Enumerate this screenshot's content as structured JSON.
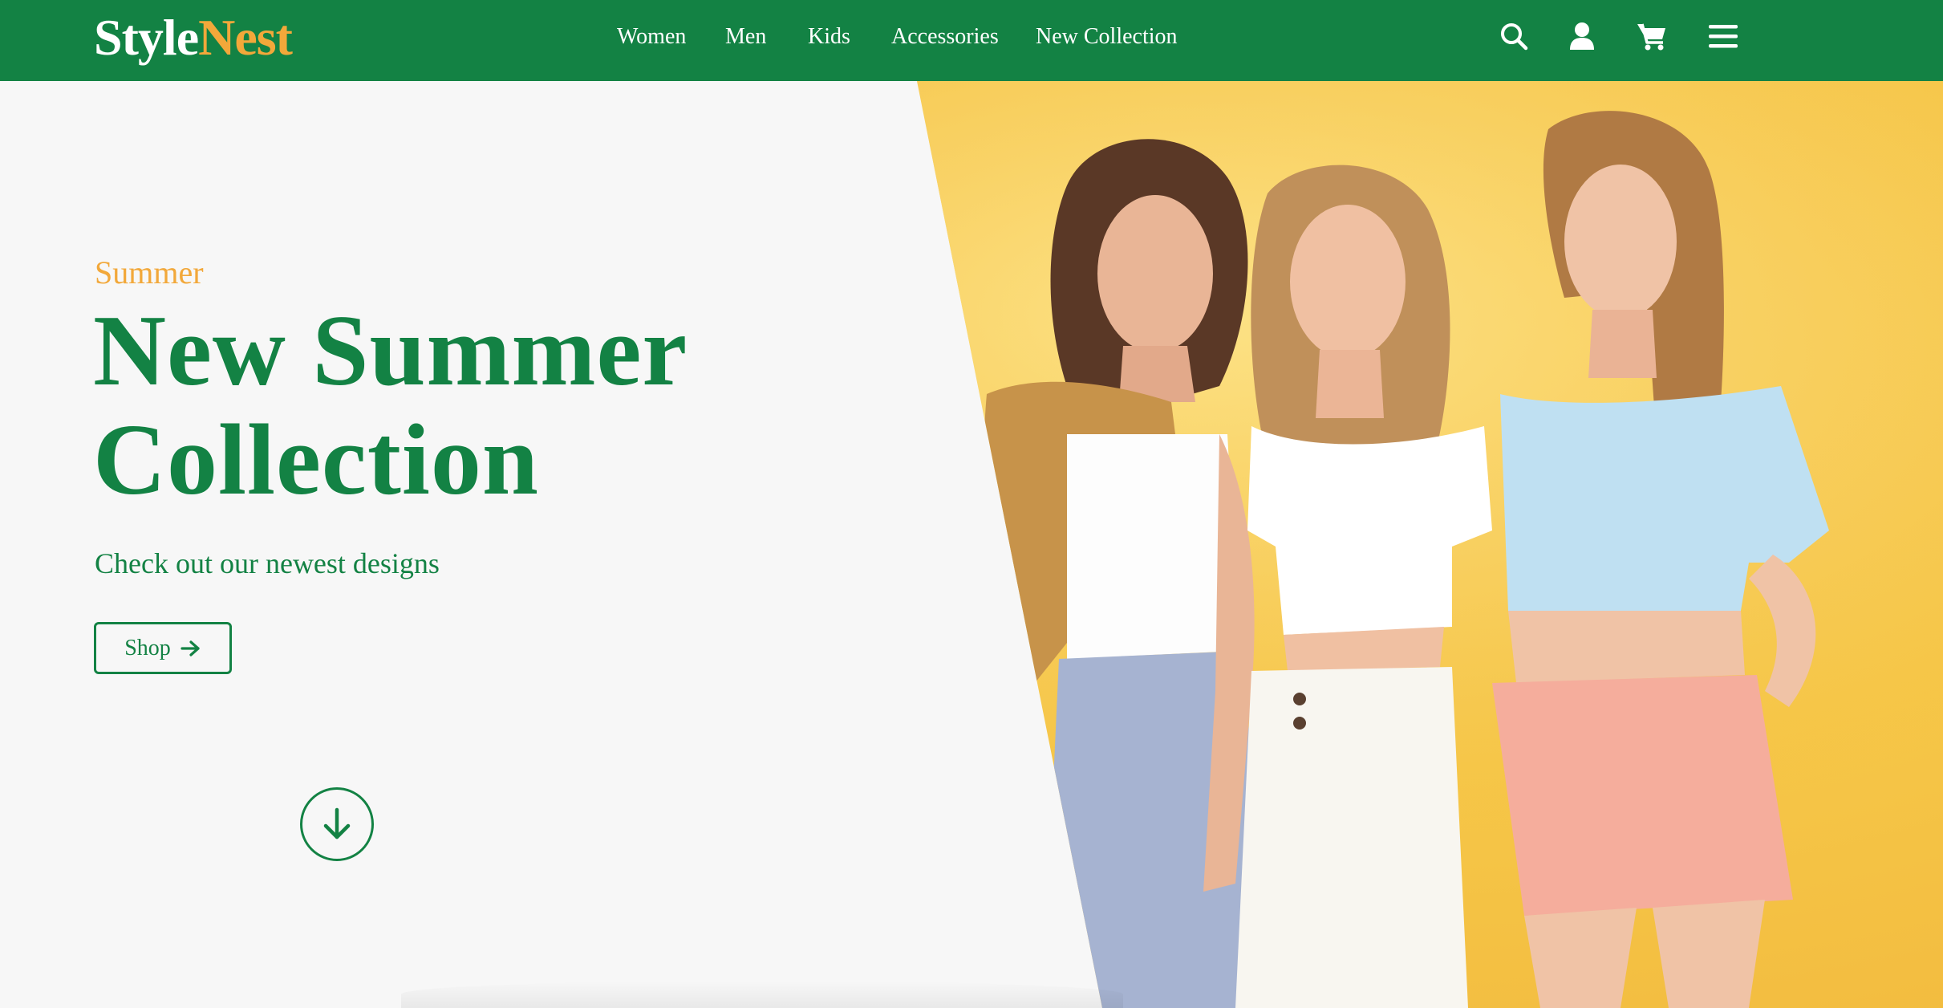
{
  "brand": {
    "part1": "Style",
    "part2": "Nest"
  },
  "nav": {
    "links": [
      {
        "label": "Women"
      },
      {
        "label": "Men"
      },
      {
        "label": "Kids"
      },
      {
        "label": "Accessories"
      },
      {
        "label": "New Collection"
      }
    ],
    "icons": [
      "search-icon",
      "user-icon",
      "cart-icon",
      "menu-icon"
    ]
  },
  "hero": {
    "eyebrow": "Summer",
    "title_line1": "New Summer",
    "title_line2": "Collection",
    "subtitle": "Check out our newest designs",
    "cta_label": "Shop",
    "cta_icon": "arrow-right-icon",
    "scroll_icon": "arrow-down-icon"
  },
  "colors": {
    "primary_green": "#138244",
    "accent_orange": "#f2a83a",
    "background": "#f7f7f7",
    "photo_background": "#f6c748"
  }
}
